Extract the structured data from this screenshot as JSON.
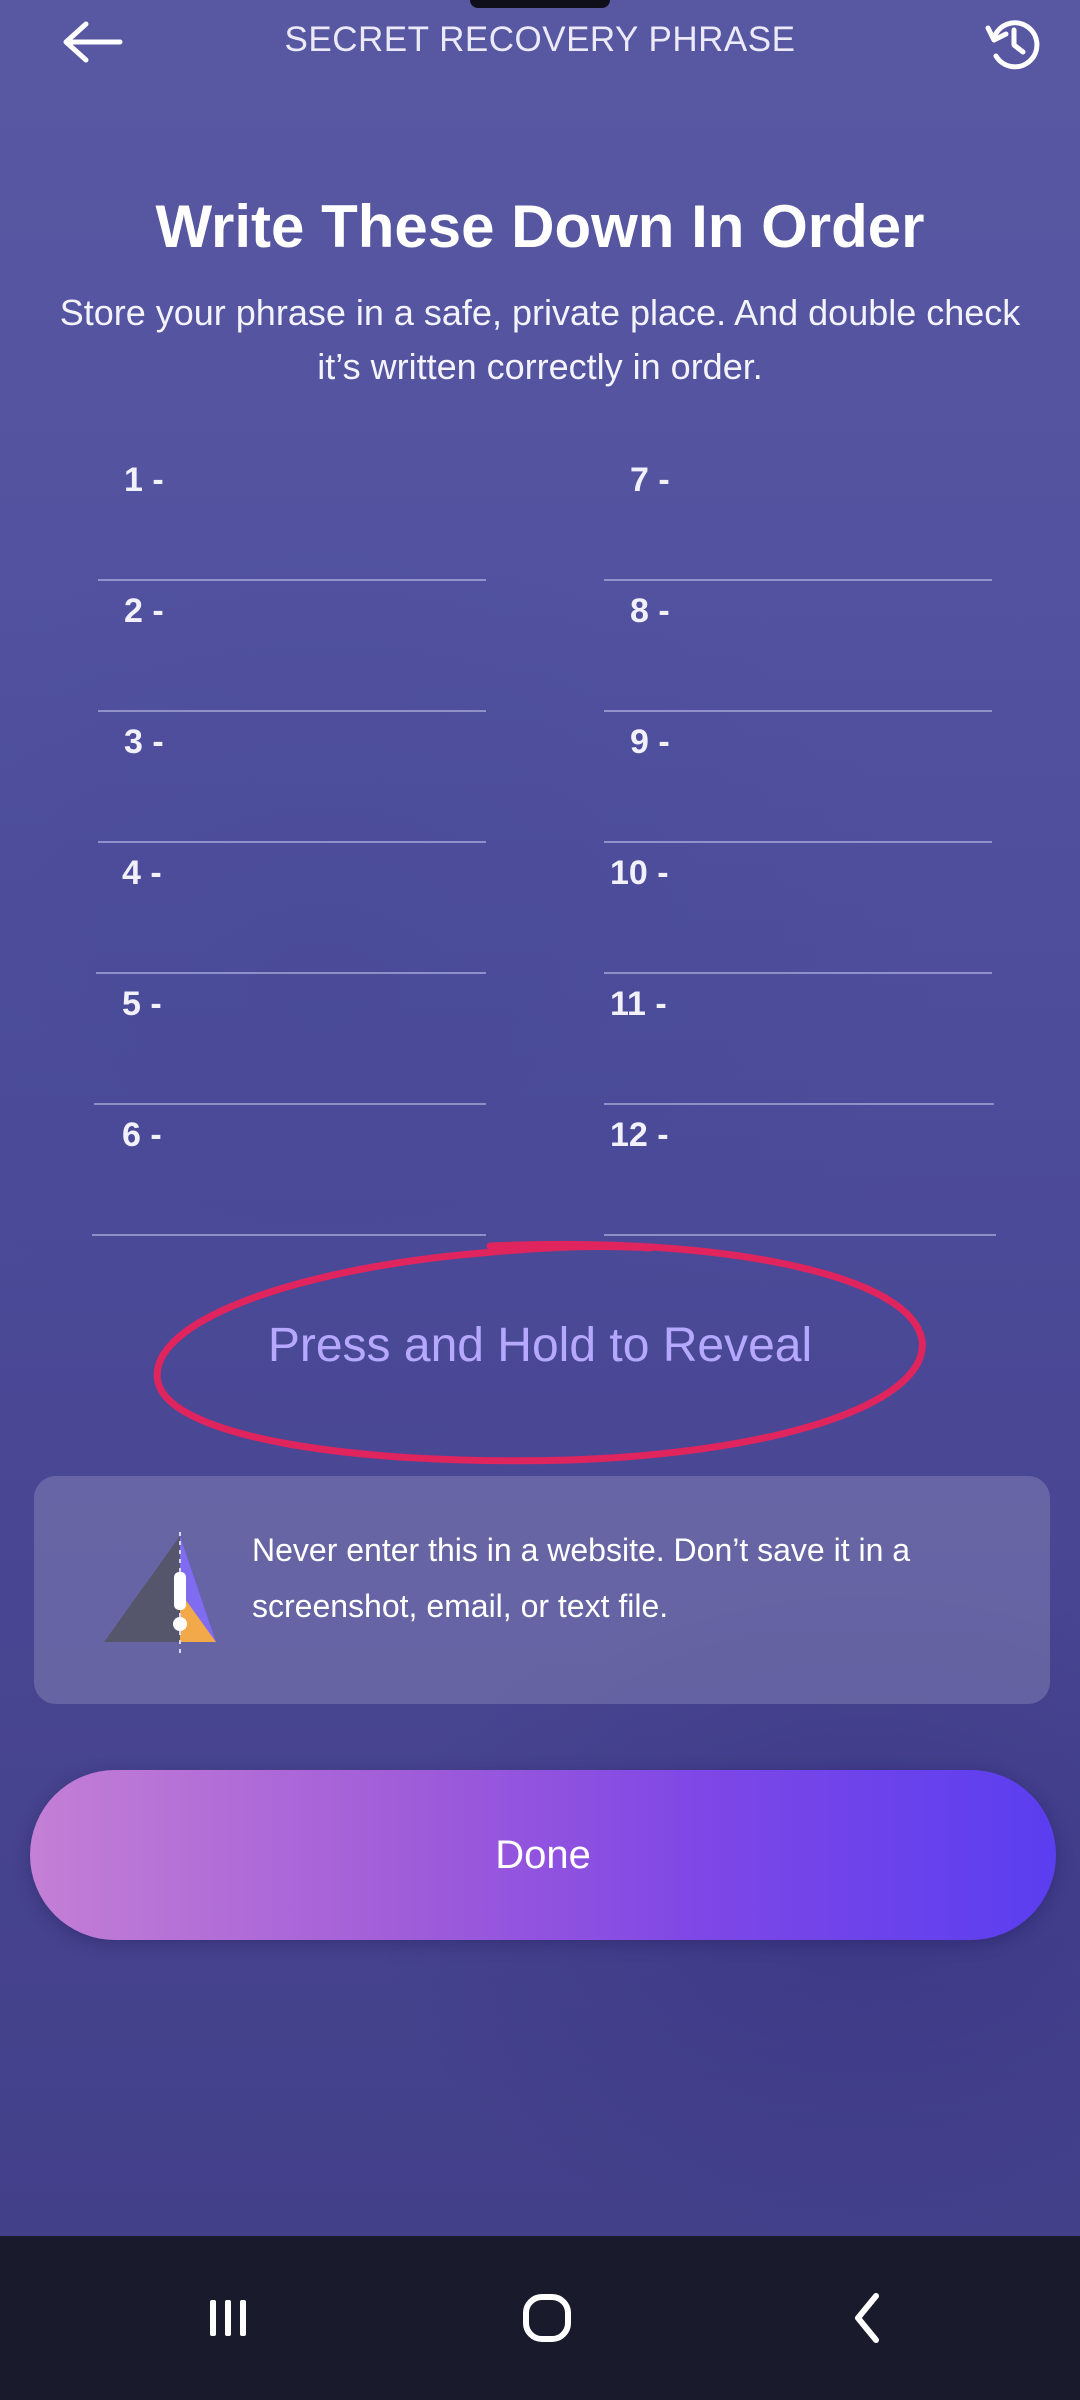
{
  "header": {
    "title": "SECRET RECOVERY PHRASE",
    "back_icon": "arrow-left-icon",
    "history_icon": "history-clock-icon"
  },
  "intro": {
    "title": "Write These Down In Order",
    "subtitle": "Store your phrase in a safe, private place. And double check it’s written correctly in order."
  },
  "words": {
    "left": [
      {
        "label": "1  -"
      },
      {
        "label": "2  -"
      },
      {
        "label": "3  -"
      },
      {
        "label": "4  -"
      },
      {
        "label": "5  -"
      },
      {
        "label": "6  -"
      }
    ],
    "right": [
      {
        "label": "7  -"
      },
      {
        "label": "8  -"
      },
      {
        "label": "9  -"
      },
      {
        "label": "10  -"
      },
      {
        "label": "11  -"
      },
      {
        "label": "12  -"
      }
    ]
  },
  "reveal": {
    "label": "Press and Hold to Reveal"
  },
  "warning": {
    "text": "Never enter this in a website. Don’t save it in a screenshot, email, or text file.",
    "icon": "warning-triangle-icon"
  },
  "done_button": {
    "label": "Done"
  },
  "colors": {
    "accent": "#b6a8ff",
    "annotation_ring": "#e0245e",
    "button_start": "#c47fd6",
    "button_end": "#5a3ef0"
  },
  "nav": {
    "recents_icon": "recents-icon",
    "home_icon": "home-icon",
    "back_icon": "nav-back-icon"
  }
}
